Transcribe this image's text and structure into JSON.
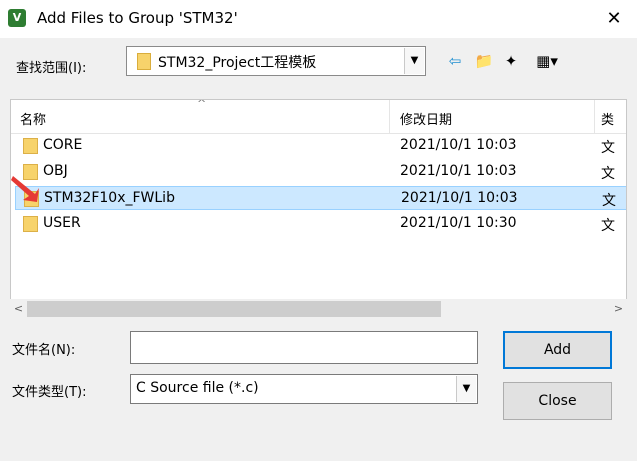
{
  "window": {
    "title": "Add Files to Group 'STM32'",
    "icon": "keil-icon",
    "close_glyph": "✕"
  },
  "lookin": {
    "label": "查找范围(I):",
    "value": "STM32_Project工程模板",
    "arrow": "▼"
  },
  "toolbar": {
    "back_glyph": "⇦",
    "up_glyph": "📁",
    "new_folder_glyph": "✦",
    "view_glyph": "▦▾"
  },
  "list": {
    "headers": {
      "name": "名称",
      "date": "修改日期",
      "type": "类"
    },
    "rows": [
      {
        "name": "CORE",
        "date": "2021/10/1 10:03",
        "type": "文",
        "selected": false
      },
      {
        "name": "OBJ",
        "date": "2021/10/1 10:03",
        "type": "文",
        "selected": false
      },
      {
        "name": "STM32F10x_FWLib",
        "date": "2021/10/1 10:03",
        "type": "文",
        "selected": true
      },
      {
        "name": "USER",
        "date": "2021/10/1 10:30",
        "type": "文",
        "selected": false
      }
    ],
    "sort_glyph": "^"
  },
  "scroll": {
    "left": "<",
    "right": ">"
  },
  "filename": {
    "label": "文件名(N):",
    "value": ""
  },
  "filetype": {
    "label": "文件类型(T):",
    "value": "C Source file (*.c)",
    "arrow": "▼"
  },
  "buttons": {
    "add": "Add",
    "close": "Close"
  },
  "colors": {
    "selection": "#cce8ff",
    "default_button_border": "#0078d7",
    "annotation_arrow": "#e53935"
  }
}
